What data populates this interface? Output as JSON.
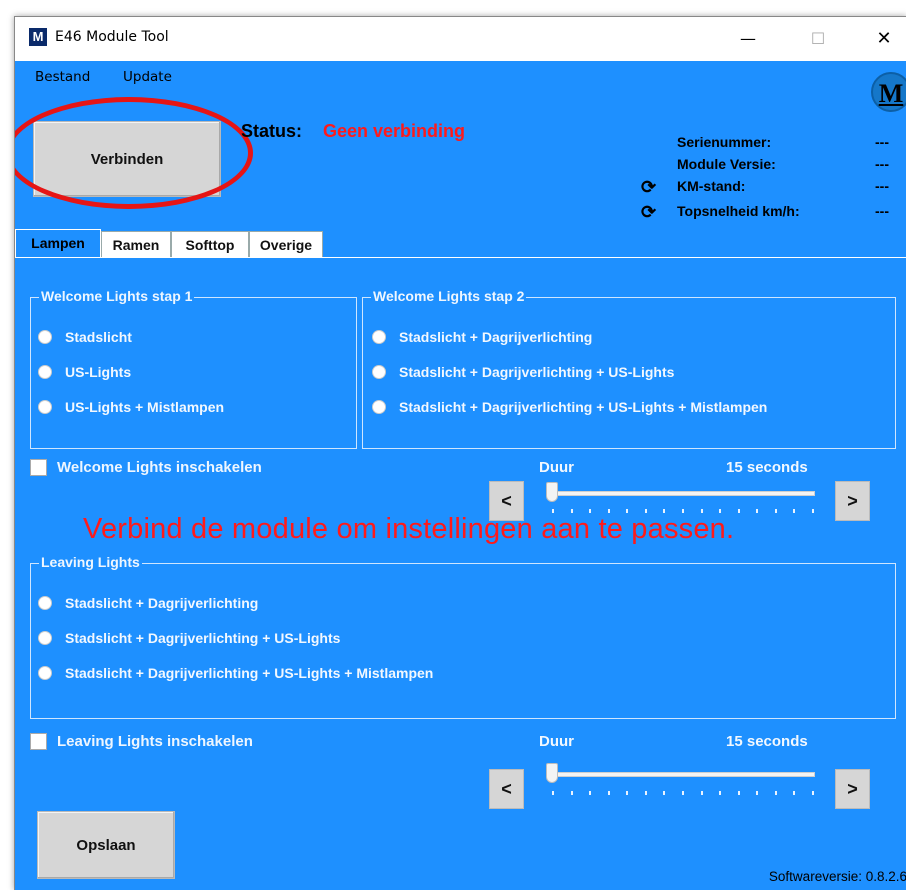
{
  "window": {
    "app_icon_letter": "M",
    "title": "E46 Module Tool",
    "minimize": "—",
    "maximize": "☐",
    "close": "✕"
  },
  "menu": {
    "items": [
      "Bestand",
      "Update"
    ]
  },
  "logo_letter": "M",
  "connect_button": "Verbinden",
  "status": {
    "label": "Status:",
    "value": "Geen verbinding",
    "value_color": "#ff1a1a"
  },
  "info": [
    {
      "label": "Serienummer:",
      "value": "---",
      "icon": ""
    },
    {
      "label": "Module Versie:",
      "value": "---",
      "icon": ""
    },
    {
      "label": "KM-stand:",
      "value": "---",
      "icon": "refresh-icon"
    },
    {
      "label": "Topsnelheid km/h:",
      "value": "---",
      "icon": "refresh-icon"
    }
  ],
  "tabs": [
    {
      "label": "Lampen",
      "active": true
    },
    {
      "label": "Ramen",
      "active": false
    },
    {
      "label": "Softtop",
      "active": false
    },
    {
      "label": "Overige",
      "active": false
    }
  ],
  "welcome_step1": {
    "title": "Welcome Lights stap 1",
    "options": [
      "Stadslicht",
      "US-Lights",
      "US-Lights + Mistlampen"
    ]
  },
  "welcome_step2": {
    "title": "Welcome Lights stap 2",
    "options": [
      "Stadslicht + Dagrijverlichting",
      "Stadslicht + Dagrijverlichting + US-Lights",
      "Stadslicht + Dagrijverlichting + US-Lights + Mistlampen"
    ]
  },
  "welcome_enable": {
    "label": "Welcome Lights inschakelen",
    "checked": false
  },
  "welcome_duration": {
    "label": "Duur",
    "value_text": "15 seconds",
    "prev": "<",
    "next": ">"
  },
  "warning_text": "Verbind de module om instellingen aan te passen.",
  "leaving": {
    "title": "Leaving Lights",
    "options": [
      "Stadslicht + Dagrijverlichting",
      "Stadslicht + Dagrijverlichting + US-Lights",
      "Stadslicht + Dagrijverlichting + US-Lights + Mistlampen"
    ]
  },
  "leaving_enable": {
    "label": "Leaving Lights inschakelen",
    "checked": false
  },
  "leaving_duration": {
    "label": "Duur",
    "value_text": "15 seconds",
    "prev": "<",
    "next": ">"
  },
  "save_button": "Opslaan",
  "software_version": "Softwareversie:  0.8.2.6",
  "colors": {
    "panel": "#1e90ff",
    "alert": "#ff1a1a"
  }
}
